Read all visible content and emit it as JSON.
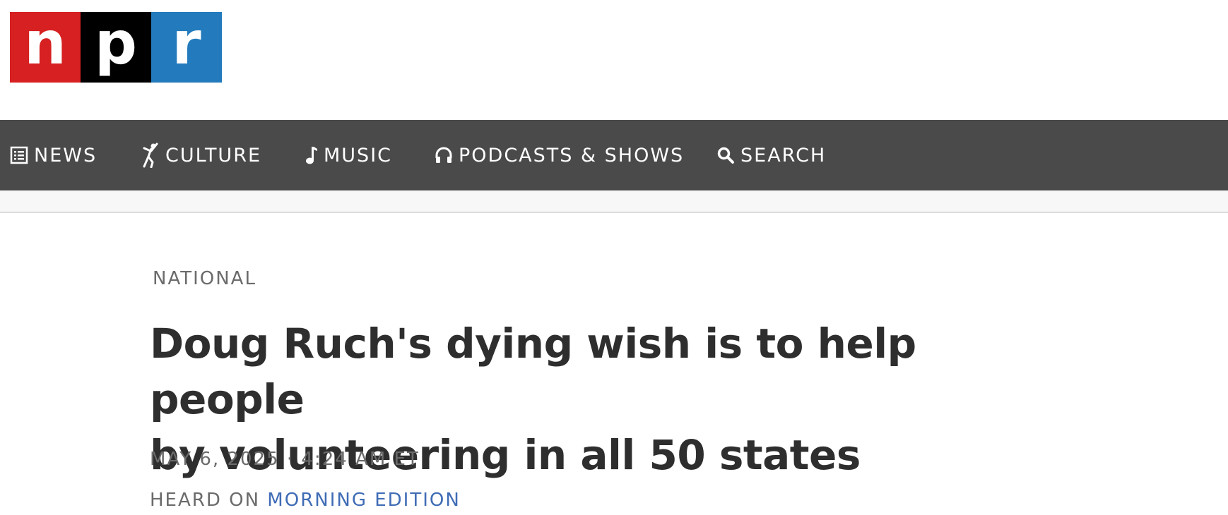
{
  "logo": {
    "letters": [
      "n",
      "p",
      "r"
    ],
    "colors": [
      "#d62021",
      "#000000",
      "#237bbd"
    ]
  },
  "nav": {
    "items": [
      {
        "label": "NEWS",
        "icon": "news-list-icon"
      },
      {
        "label": "CULTURE",
        "icon": "dancer-icon"
      },
      {
        "label": "MUSIC",
        "icon": "music-note-icon"
      },
      {
        "label": "PODCASTS & SHOWS",
        "icon": "headphones-icon"
      },
      {
        "label": "SEARCH",
        "icon": "search-icon"
      }
    ],
    "background": "#4a4a4a"
  },
  "article": {
    "category": "NATIONAL",
    "headline_line1": "Doug Ruch's dying wish is to help people",
    "headline_line2": "by volunteering in all 50 states",
    "date": "MAY 6, 2025",
    "separator": "·",
    "time": "4:24 AM ET",
    "heard_on_label": "HEARD ON",
    "heard_on_show": "MORNING EDITION",
    "link_color": "#3f6cb5"
  }
}
